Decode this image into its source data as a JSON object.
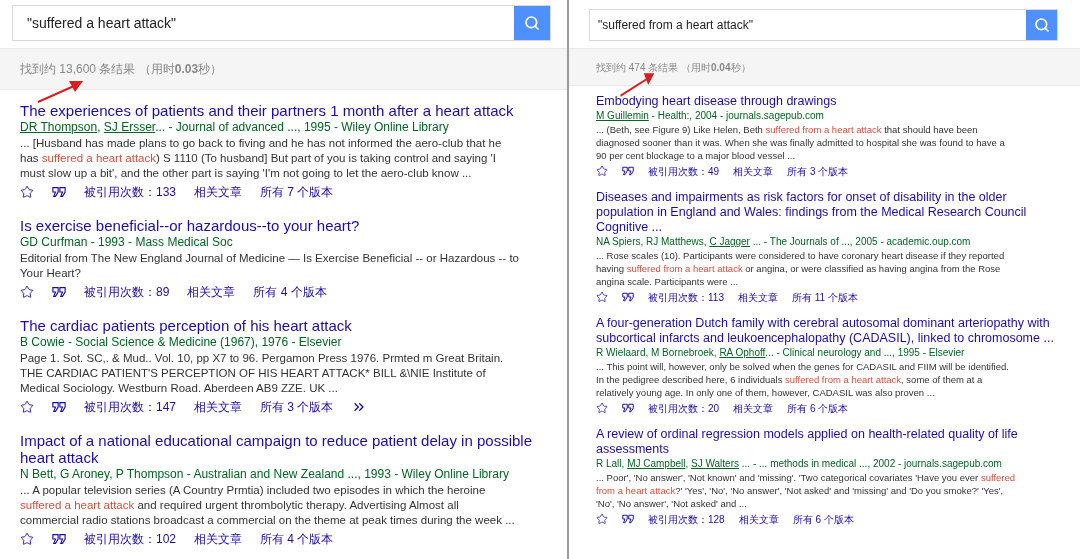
{
  "panels": [
    {
      "query": "\"suffered a heart attack\"",
      "stats": "找到约 13,600 条结果 （用时**0.03**秒）",
      "annotated": true,
      "results": [
        {
          "title": "The experiences of patients and their partners 1 month after a heart attack",
          "authors": [
            {
              "text": "DR Thompson",
              "link": true
            },
            {
              "text": ", ",
              "link": false
            },
            {
              "text": "SJ Ersser",
              "link": true
            }
          ],
          "source": "... - Journal of advanced ..., 1995 - Wiley Online Library",
          "snippet": [
            {
              "text": "... [Husband has made plans to go back to fiving and he has not informed the aero-club that he has ",
              "highlight": false
            },
            {
              "text": "suffered a heart attack",
              "highlight": true
            },
            {
              "text": ") S 1110 (To husband] But part of you is taking control and saying 'I must slow up a bit', and the other part is saying 'I'm not going to let the aero-club know ...",
              "highlight": false
            }
          ],
          "cited": "被引用次数：133",
          "related": "相关文章",
          "versions": "所有 7 个版本",
          "more": false
        },
        {
          "title": "Is exercise beneficial--or hazardous--to your heart?",
          "authors": [
            {
              "text": "GD Curfman",
              "link": false
            }
          ],
          "source": " - 1993 - Mass Medical Soc",
          "snippet": [
            {
              "text": "Editorial from The New England Journal of Medicine — Is Exercise Beneficial -- or Hazardous -- to Your Heart?",
              "highlight": false
            }
          ],
          "cited": "被引用次数：89",
          "related": "相关文章",
          "versions": "所有 4 个版本",
          "more": false
        },
        {
          "title": "The cardiac patients perception of his heart attack",
          "authors": [
            {
              "text": "B Cowie",
              "link": false
            }
          ],
          "source": " - Social Science & Medicine (1967), 1976 - Elsevier",
          "snippet": [
            {
              "text": "Page 1. Sot. SC,. & Mud.. Vol. 10, pp X7 to 96. Pergamon Press 1976. Prmted m Great Britain. THE CARDIAC PATIENT'S PERCEPTION OF HIS HEART ATTACK* BILL &\\NIE Institute of Medical Sociology. Westburn Road. Aberdeen AB9 ZZE. UK ...",
              "highlight": false
            }
          ],
          "cited": "被引用次数：147",
          "related": "相关文章",
          "versions": "所有 3 个版本",
          "more": true
        },
        {
          "title": "Impact of a national educational campaign to reduce patient delay in possible heart attack",
          "authors": [
            {
              "text": "N Bett, G Aroney, P Thompson",
              "link": false
            }
          ],
          "source": " - Australian and New Zealand ..., 1993 - Wiley Online Library",
          "snippet": [
            {
              "text": "... A popular television series (A Country Prmtia) included two episodes in which the heroine ",
              "highlight": false
            },
            {
              "text": "suffered a heart attack",
              "highlight": true
            },
            {
              "text": " and required urgent thrombolytic therapy. Advertising Almost all commercial radio stations broadcast a commercial on the theme at peak times during the week ...",
              "highlight": false
            }
          ],
          "cited": "被引用次数：102",
          "related": "相关文章",
          "versions": "所有 4 个版本",
          "more": false
        }
      ]
    },
    {
      "query": "\"suffered from a heart attack\"",
      "stats": "找到约 474 条结果 （用时**0.04**秒）",
      "annotated": true,
      "results": [
        {
          "title": "Embodying heart disease through drawings",
          "authors": [
            {
              "text": "M Guillemin",
              "link": true
            }
          ],
          "source": " - Health:, 2004 - journals.sagepub.com",
          "snippet": [
            {
              "text": "... (Beth, see Figure 9) Like Helen, Beth ",
              "highlight": false
            },
            {
              "text": "suffered from a heart attack",
              "highlight": true
            },
            {
              "text": " that should have been diagnosed sooner than it was. When she was finally admitted to hospital she was found to have a 90 per cent blockage to a major blood vessel ...",
              "highlight": false
            }
          ],
          "cited": "被引用次数：49",
          "related": "相关文章",
          "versions": "所有 3 个版本",
          "more": false
        },
        {
          "title": "Diseases and impairments as risk factors for onset of disability in the older population in England and Wales: findings from the Medical Research Council Cognitive ...",
          "authors": [
            {
              "text": "NA Spiers, RJ Matthews, ",
              "link": false
            },
            {
              "text": "C Jagger",
              "link": true
            }
          ],
          "source": " ... - The Journals of ..., 2005 - academic.oup.com",
          "snippet": [
            {
              "text": "... Rose scales (10). Participants were considered to have coronary heart disease if they reported having ",
              "highlight": false
            },
            {
              "text": "suffered from a heart attack",
              "highlight": true
            },
            {
              "text": " or angina, or were classified as having angina from the Rose angina scale. Participants were ...",
              "highlight": false
            }
          ],
          "cited": "被引用次数：113",
          "related": "相关文章",
          "versions": "所有 11 个版本",
          "more": false
        },
        {
          "title": "A four-generation Dutch family with cerebral autosomal dominant arteriopathy with subcortical infarcts and leukoencephalopathy (CADASIL), linked to chromosome ...",
          "authors": [
            {
              "text": "R Wielaard, M Bornebroek, ",
              "link": false
            },
            {
              "text": "RA Ophoff",
              "link": true
            }
          ],
          "source": "... - Clinical neurology and ..., 1995 - Elsevier",
          "snippet": [
            {
              "text": "... This point will, however, only be solved when the genes for CADASIL and FIIM will be identified. In the pedigree described here, 6 individuals ",
              "highlight": false
            },
            {
              "text": "suffered from a heart attack",
              "highlight": true
            },
            {
              "text": ", some of them at a relatively young age. In only one of them, however, CADASIL was also proven ...",
              "highlight": false
            }
          ],
          "cited": "被引用次数：20",
          "related": "相关文章",
          "versions": "所有 6 个版本",
          "more": false
        },
        {
          "title": "A review of ordinal regression models applied on health-related quality of life assessments",
          "authors": [
            {
              "text": "R Lall, ",
              "link": false
            },
            {
              "text": "MJ Campbell",
              "link": true
            },
            {
              "text": ", ",
              "link": false
            },
            {
              "text": "SJ Walters",
              "link": true
            }
          ],
          "source": " ... - ... methods in medical ..., 2002 - journals.sagepub.com",
          "snippet": [
            {
              "text": "... Poor', 'No answer', 'Not known' and 'missing'. 'Two categorical covariates 'Have you ever ",
              "highlight": false
            },
            {
              "text": "suffered from a heart attack",
              "highlight": true
            },
            {
              "text": "?' 'Yes', 'No', 'No answer', 'Not asked' and 'missing' and 'Do you smoke?' 'Yes', 'No', 'No answer', 'Not asked' and ...",
              "highlight": false
            }
          ],
          "cited": "被引用次数：128",
          "related": "相关文章",
          "versions": "所有 6 个版本",
          "more": false
        }
      ]
    }
  ]
}
